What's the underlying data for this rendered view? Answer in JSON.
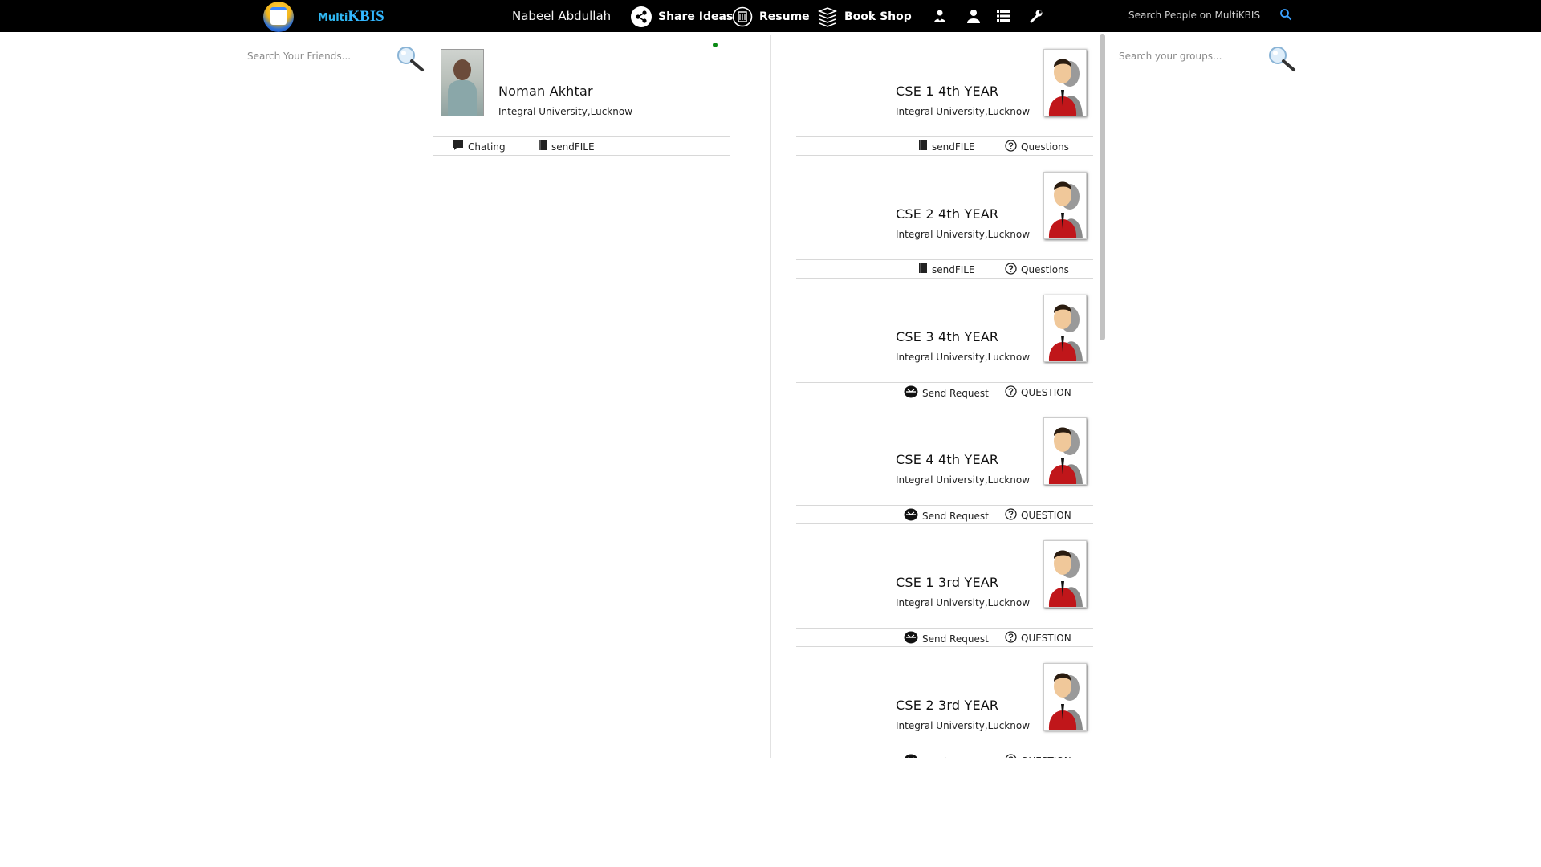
{
  "header": {
    "brand_prefix": "Multi",
    "brand_main": "KBIS",
    "user_name": "Nabeel Abdullah",
    "nav": [
      {
        "label": "Share Ideas",
        "icon": "share-icon"
      },
      {
        "label": "Resume",
        "icon": "resume-icon"
      },
      {
        "label": "Book Shop",
        "icon": "books-icon"
      }
    ],
    "icon_buttons": [
      "user-group-icon",
      "profile-icon",
      "list-icon",
      "wrench-icon"
    ],
    "search": {
      "placeholder": "Search People on MultiKBIS",
      "value": ""
    }
  },
  "friends_panel": {
    "search": {
      "placeholder": "Search Your Friends...",
      "value": ""
    }
  },
  "groups_panel": {
    "search": {
      "placeholder": "Search your groups...",
      "value": ""
    }
  },
  "friend": {
    "name": "Noman Akhtar",
    "university": "Integral University,Lucknow",
    "online": true,
    "actions": [
      {
        "label": "Chating",
        "icon": "chat-icon"
      },
      {
        "label": "sendFILE",
        "icon": "file-icon"
      }
    ]
  },
  "groups": [
    {
      "name": "CSE 1 4th YEAR",
      "university": "Integral University,Lucknow",
      "actions": [
        {
          "label": "sendFILE",
          "icon": "file-icon"
        },
        {
          "label": "Questions",
          "icon": "question-icon"
        }
      ]
    },
    {
      "name": "CSE 2 4th YEAR",
      "university": "Integral University,Lucknow",
      "actions": [
        {
          "label": "sendFILE",
          "icon": "file-icon"
        },
        {
          "label": "Questions",
          "icon": "question-icon"
        }
      ]
    },
    {
      "name": "CSE 3 4th YEAR",
      "university": "Integral University,Lucknow",
      "actions": [
        {
          "label": "Send Request",
          "icon": "send-request-icon"
        },
        {
          "label": "QUESTION",
          "icon": "question-icon"
        }
      ]
    },
    {
      "name": "CSE 4 4th YEAR",
      "university": "Integral University,Lucknow",
      "actions": [
        {
          "label": "Send Request",
          "icon": "send-request-icon"
        },
        {
          "label": "QUESTION",
          "icon": "question-icon"
        }
      ]
    },
    {
      "name": "CSE 1 3rd YEAR",
      "university": "Integral University,Lucknow",
      "actions": [
        {
          "label": "Send Request",
          "icon": "send-request-icon"
        },
        {
          "label": "QUESTION",
          "icon": "question-icon"
        }
      ]
    },
    {
      "name": "CSE 2 3rd YEAR",
      "university": "Integral University,Lucknow",
      "actions": [
        {
          "label": "Send Request",
          "icon": "send-request-icon"
        },
        {
          "label": "QUESTION",
          "icon": "question-icon"
        }
      ]
    }
  ],
  "colors": {
    "topbar": "#000000",
    "brand": "#33b7ff",
    "online": "#0a8a14"
  }
}
